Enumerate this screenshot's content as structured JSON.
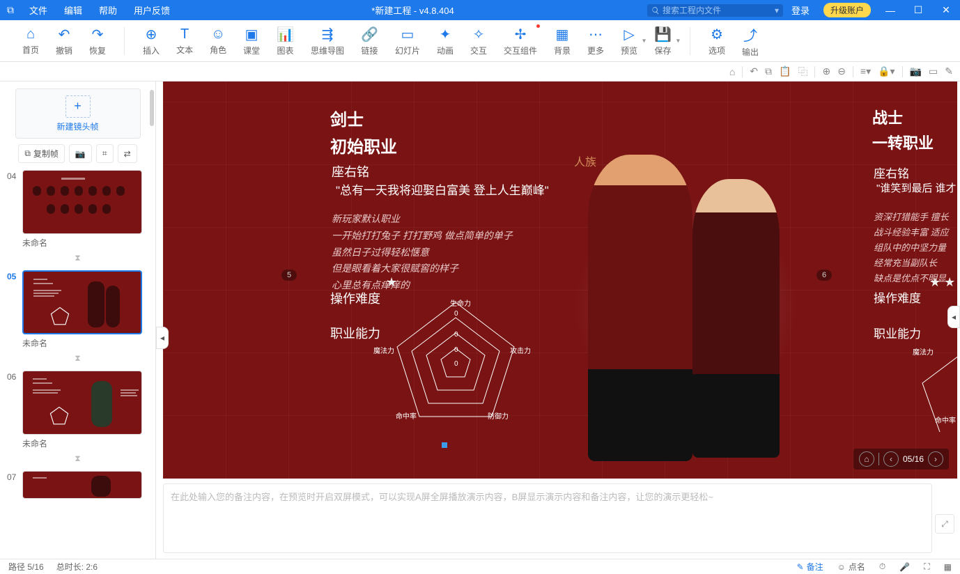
{
  "titlebar": {
    "menu": {
      "file": "文件",
      "edit": "编辑",
      "help": "帮助",
      "feedback": "用户反馈"
    },
    "title": "*新建工程 - v4.8.404",
    "search_placeholder": "搜索工程内文件",
    "login": "登录",
    "upgrade": "升级账户"
  },
  "toolbar": {
    "home": "首页",
    "undo": "撤销",
    "redo": "恢复",
    "insert": "插入",
    "text": "文本",
    "role": "角色",
    "classroom": "课堂",
    "chart": "图表",
    "mindmap": "思维导图",
    "link": "链接",
    "slides": "幻灯片",
    "anim": "动画",
    "interact": "交互",
    "component": "交互组件",
    "background": "背景",
    "more": "更多",
    "preview": "预览",
    "save": "保存",
    "options": "选项",
    "output": "输出"
  },
  "sidebar": {
    "new_frame": "新建镜头帧",
    "copy_frame": "复制帧",
    "frames": [
      {
        "num": "04",
        "name": "未命名"
      },
      {
        "num": "05",
        "name": "未命名"
      },
      {
        "num": "06",
        "name": "未命名"
      },
      {
        "num": "07",
        "name": ""
      }
    ]
  },
  "slide": {
    "left": {
      "cls": "剑士",
      "subcls": "初始职业",
      "motto_h": "座右铭",
      "motto_q": "\"总有一天我将迎娶白富美  登上人生巅峰\"",
      "desc1": "新玩家默认职业",
      "desc2": "一开始打打兔子  打打野鸡  做点简单的单子",
      "desc3": "虽然日子过得轻松惬意",
      "desc4": "但是眼看着大家很赋窖的样子",
      "desc5": "心里总有点痒痒的",
      "diff_h": "操作难度",
      "abil_h": "职业能力",
      "radar": {
        "hp": "生命力",
        "atk": "攻击力",
        "def": "防御力",
        "hit": "命中率",
        "mp": "魔法力",
        "v": "0"
      },
      "race": "人族"
    },
    "right": {
      "cls": "战士",
      "subcls": "一转职业",
      "motto_h": "座右铭",
      "motto_q": "\"谁笑到最后  谁才",
      "desc1": "资深打猎能手  擅长",
      "desc2": "战斗经验丰富 适应",
      "desc3": "组队中的中坚力量",
      "desc4": "经常充当副队长",
      "desc5": "缺点是优点不明显",
      "diff_h": "操作难度",
      "abil_h": "职业能力",
      "mp": "魔法力",
      "hit": "命中率"
    },
    "nav_prev": "5",
    "nav_next": "6",
    "page": "05/16"
  },
  "note": {
    "placeholder": "在此处输入您的备注内容，在预览时开启双屏模式，可以实现A屏全屏播放演示内容，B屏显示演示内容和备注内容，让您的演示更轻松~"
  },
  "status": {
    "path": "路径 5/16",
    "duration": "总时长: 2:6",
    "remarks": "备注",
    "roll": "点名"
  }
}
